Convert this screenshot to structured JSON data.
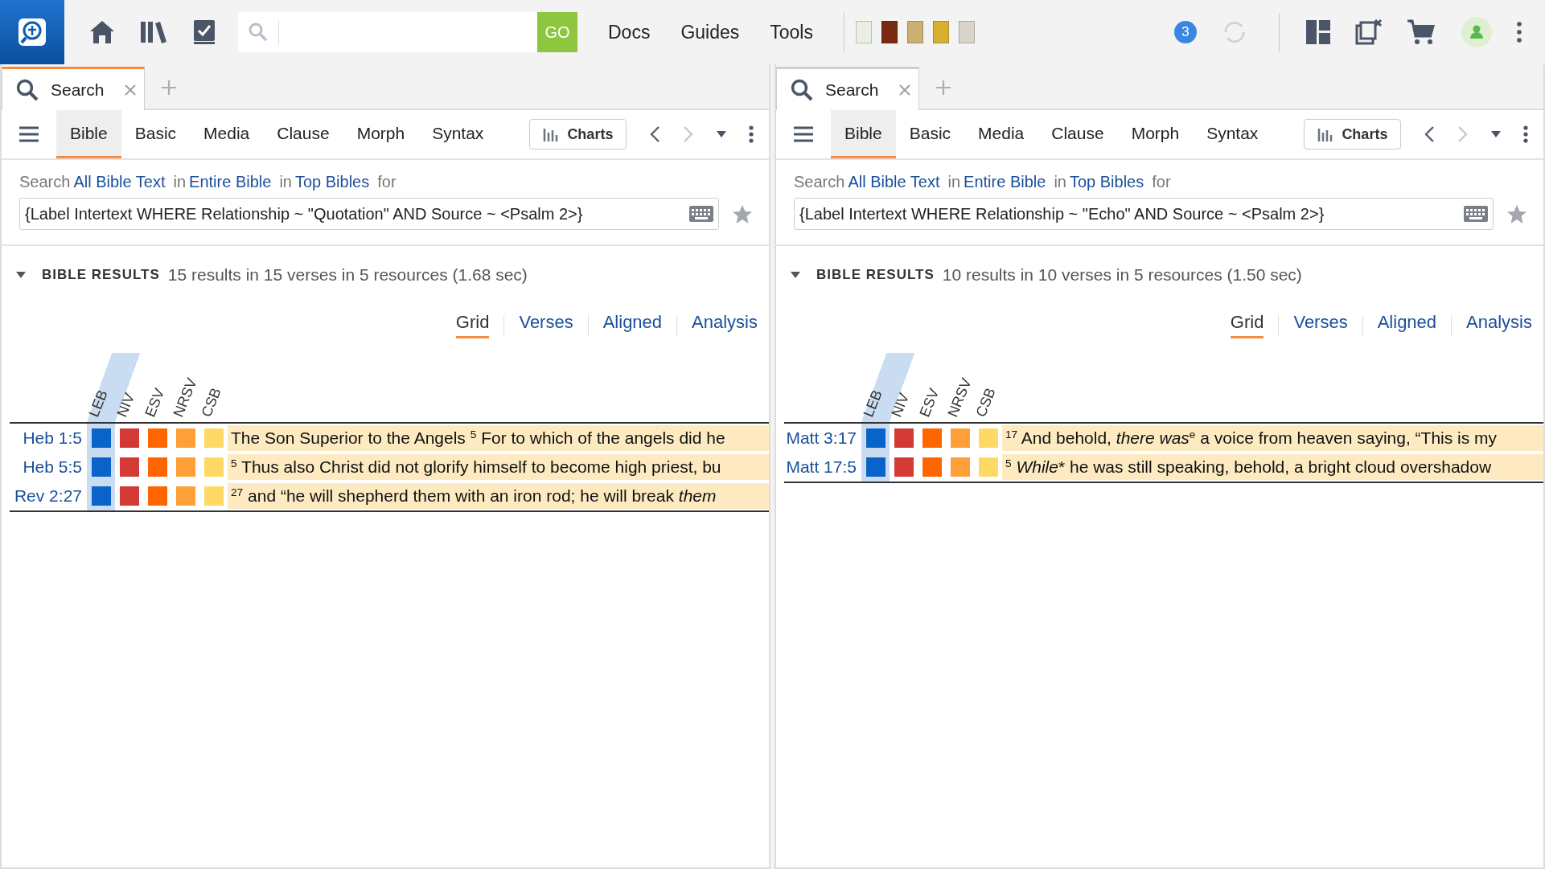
{
  "top_bar": {
    "go_button": "GO",
    "nav_links": [
      "Docs",
      "Guides",
      "Tools"
    ],
    "book_covers": [
      {
        "color": "#e8efe4"
      },
      {
        "color": "#7a2a10"
      },
      {
        "color": "#c9b070"
      },
      {
        "color": "#d8b030"
      },
      {
        "color": "#d9d4c8"
      }
    ],
    "notification_count": "3"
  },
  "panels": [
    {
      "tab": {
        "label": "Search",
        "active": true
      },
      "subtabs": [
        {
          "label": "Bible",
          "selected": true
        },
        {
          "label": "Basic",
          "selected": false
        },
        {
          "label": "Media",
          "selected": false
        },
        {
          "label": "Clause",
          "selected": false
        },
        {
          "label": "Morph",
          "selected": false
        },
        {
          "label": "Syntax",
          "selected": false
        }
      ],
      "charts_button": "Charts",
      "search_line": [
        {
          "kind": "label",
          "text": "Search"
        },
        {
          "kind": "link",
          "text": "All Bible Text"
        },
        {
          "kind": "label",
          "text": "in"
        },
        {
          "kind": "link",
          "text": "Entire Bible"
        },
        {
          "kind": "label",
          "text": "in"
        },
        {
          "kind": "link",
          "text": "Top Bibles"
        },
        {
          "kind": "label",
          "text": "for"
        }
      ],
      "query": "{Label Intertext WHERE Relationship ~ \"Quotation\" AND Source ~ <Psalm 2>}",
      "results": {
        "heading": "BIBLE RESULTS",
        "summary": "15 results in 15 verses in 5 resources (1.68 sec)",
        "expanded": true
      },
      "views": [
        {
          "label": "Grid",
          "selected": true
        },
        {
          "label": "Verses",
          "selected": false
        },
        {
          "label": "Aligned",
          "selected": false
        },
        {
          "label": "Analysis",
          "selected": false
        }
      ],
      "versions": [
        {
          "label": "LEB",
          "color": "#0a63c9",
          "selected": true
        },
        {
          "label": "NIV",
          "color": "#d33a36",
          "selected": false
        },
        {
          "label": "ESV",
          "color": "#ff6600",
          "selected": false
        },
        {
          "label": "NRSV",
          "color": "#ff9f38",
          "selected": false
        },
        {
          "label": "CSB",
          "color": "#ffd966",
          "selected": false
        }
      ],
      "rows": [
        {
          "reference": "Heb 1:5",
          "text": [
            {
              "kind": "plain",
              "text": "The Son Superior to the Angels "
            },
            {
              "kind": "sup",
              "text": "5"
            },
            {
              "kind": "plain",
              "text": " For to which of the angels did he"
            }
          ]
        },
        {
          "reference": "Heb 5:5",
          "text": [
            {
              "kind": "sup",
              "text": "5"
            },
            {
              "kind": "plain",
              "text": " Thus also Christ did not glorify himself to become high priest, bu"
            }
          ]
        },
        {
          "reference": "Rev 2:27",
          "text": [
            {
              "kind": "sup",
              "text": "27"
            },
            {
              "kind": "plain",
              "text": " and “he will shepherd them with an iron rod; he will break "
            },
            {
              "kind": "italic",
              "text": "them"
            }
          ]
        }
      ]
    },
    {
      "tab": {
        "label": "Search",
        "active": false
      },
      "subtabs": [
        {
          "label": "Bible",
          "selected": true
        },
        {
          "label": "Basic",
          "selected": false
        },
        {
          "label": "Media",
          "selected": false
        },
        {
          "label": "Clause",
          "selected": false
        },
        {
          "label": "Morph",
          "selected": false
        },
        {
          "label": "Syntax",
          "selected": false
        }
      ],
      "charts_button": "Charts",
      "search_line": [
        {
          "kind": "label",
          "text": "Search"
        },
        {
          "kind": "link",
          "text": "All Bible Text"
        },
        {
          "kind": "label",
          "text": "in"
        },
        {
          "kind": "link",
          "text": "Entire Bible"
        },
        {
          "kind": "label",
          "text": "in"
        },
        {
          "kind": "link",
          "text": "Top Bibles"
        },
        {
          "kind": "label",
          "text": "for"
        }
      ],
      "query": "{Label Intertext WHERE Relationship ~ \"Echo\" AND Source ~ <Psalm 2>}",
      "results": {
        "heading": "BIBLE RESULTS",
        "summary": "10 results in 10 verses in 5 resources (1.50 sec)",
        "expanded": true
      },
      "views": [
        {
          "label": "Grid",
          "selected": true
        },
        {
          "label": "Verses",
          "selected": false
        },
        {
          "label": "Aligned",
          "selected": false
        },
        {
          "label": "Analysis",
          "selected": false
        }
      ],
      "versions": [
        {
          "label": "LEB",
          "color": "#0a63c9",
          "selected": true
        },
        {
          "label": "NIV",
          "color": "#d33a36",
          "selected": false
        },
        {
          "label": "ESV",
          "color": "#ff6600",
          "selected": false
        },
        {
          "label": "NRSV",
          "color": "#ff9f38",
          "selected": false
        },
        {
          "label": "CSB",
          "color": "#ffd966",
          "selected": false
        }
      ],
      "rows": [
        {
          "reference": "Matt 3:17",
          "text": [
            {
              "kind": "sup",
              "text": "17"
            },
            {
              "kind": "plain",
              "text": " And behold, "
            },
            {
              "kind": "italic",
              "text": "there was"
            },
            {
              "kind": "sup",
              "text": "e"
            },
            {
              "kind": "plain",
              "text": " a voice from heaven saying, “This is my"
            }
          ]
        },
        {
          "reference": "Matt 17:5",
          "text": [
            {
              "kind": "sup",
              "text": "5"
            },
            {
              "kind": "italic",
              "text": " While"
            },
            {
              "kind": "plain",
              "text": "* he was still speaking, behold, a bright cloud overshadow"
            }
          ]
        }
      ]
    }
  ]
}
